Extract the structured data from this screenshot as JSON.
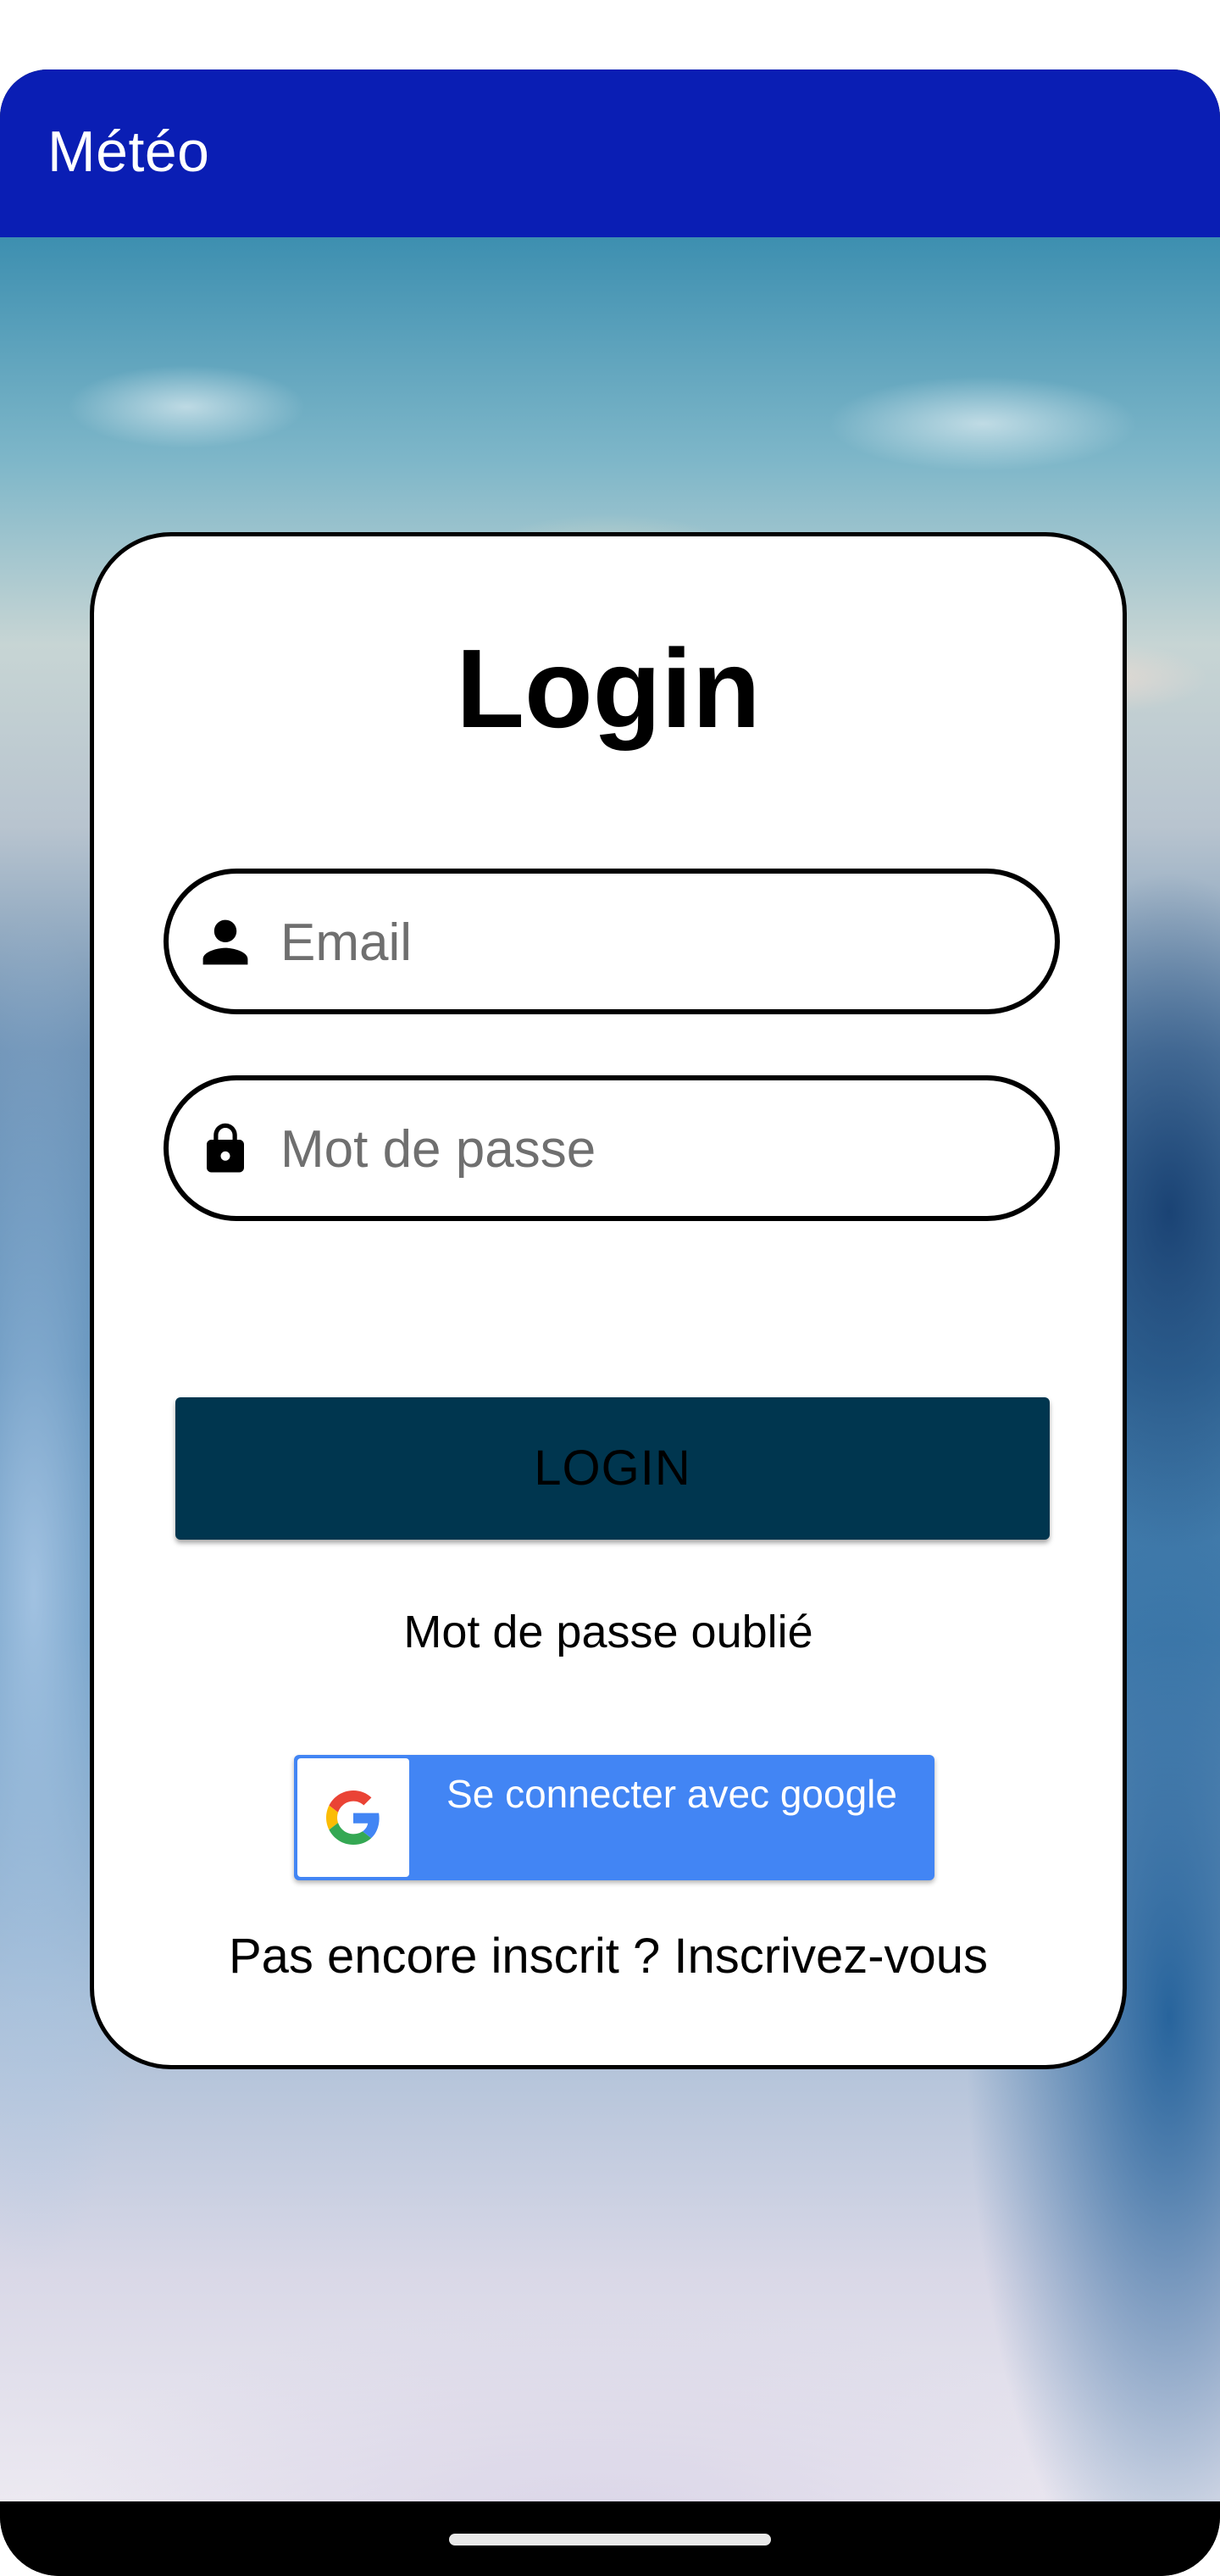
{
  "app_bar": {
    "title": "Météo",
    "color": "#0a1eb4"
  },
  "login_card": {
    "title": "Login",
    "email_field": {
      "placeholder": "Email",
      "value": "",
      "icon": "person-icon"
    },
    "password_field": {
      "placeholder": "Mot de passe",
      "value": "",
      "icon": "lock-icon"
    },
    "login_button": {
      "label": "LOGIN",
      "color": "#00364f"
    },
    "forgot_password_link": "Mot de passe oublié",
    "google_button": {
      "label": "Se connecter avec google",
      "icon": "google-logo-icon",
      "color": "#4285f4"
    },
    "register_link": "Pas encore inscrit ? Inscrivez-vous"
  },
  "background": {
    "icon": "mountain-landscape-photo"
  },
  "system_nav": {
    "home_indicator": "home-indicator"
  }
}
